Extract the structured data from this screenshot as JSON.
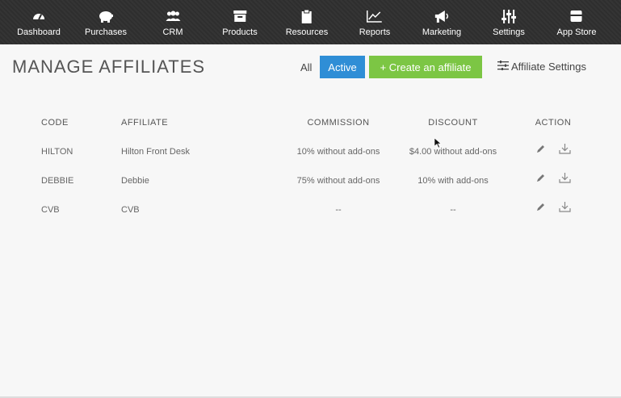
{
  "nav": [
    {
      "label": "Dashboard",
      "icon": "dashboard-icon"
    },
    {
      "label": "Purchases",
      "icon": "piggy-bank-icon"
    },
    {
      "label": "CRM",
      "icon": "users-icon"
    },
    {
      "label": "Products",
      "icon": "box-icon"
    },
    {
      "label": "Resources",
      "icon": "clipboard-icon"
    },
    {
      "label": "Reports",
      "icon": "line-chart-icon"
    },
    {
      "label": "Marketing",
      "icon": "megaphone-icon"
    },
    {
      "label": "Settings",
      "icon": "sliders-icon"
    },
    {
      "label": "App Store",
      "icon": "store-icon"
    }
  ],
  "header": {
    "title": "MANAGE AFFILIATES",
    "filter_all": "All",
    "filter_active": "Active",
    "create_label": "+ Create an affiliate",
    "settings_label": "Affiliate Settings"
  },
  "table": {
    "columns": [
      "CODE",
      "AFFILIATE",
      "COMMISSION",
      "DISCOUNT",
      "ACTION"
    ],
    "rows": [
      {
        "code": "HILTON",
        "affiliate": "Hilton Front Desk",
        "commission": "10% without add-ons",
        "discount": "$4.00 without add-ons"
      },
      {
        "code": "DEBBIE",
        "affiliate": "Debbie",
        "commission": "75% without add-ons",
        "discount": "10% with add-ons"
      },
      {
        "code": "CVB",
        "affiliate": "CVB",
        "commission": "--",
        "discount": "--"
      }
    ]
  },
  "colors": {
    "nav_bg": "#2e2e2e",
    "active_blue": "#2f8ed6",
    "create_green": "#7cc644"
  }
}
